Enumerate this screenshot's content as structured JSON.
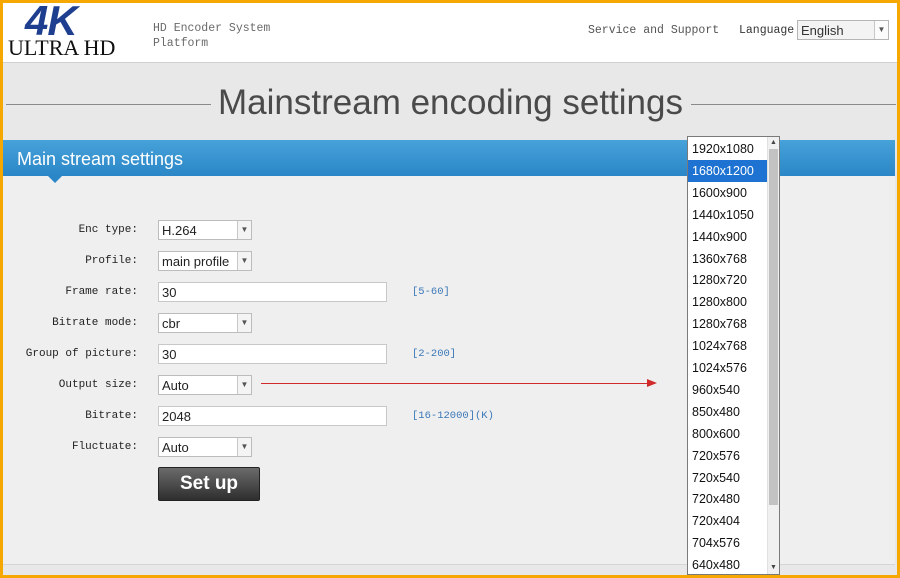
{
  "header": {
    "logo_top": "4K",
    "logo_bottom": "ULTRA HD",
    "system_title": "HD Encoder System Platform",
    "support_link": "Service and Support",
    "language_label": "Language:",
    "language_value": "English"
  },
  "page_title": "Mainstream encoding settings",
  "section_title": "Main stream settings",
  "form": {
    "enc_type": {
      "label": "Enc type:",
      "value": "H.264"
    },
    "profile": {
      "label": "Profile:",
      "value": "main profile"
    },
    "frame_rate": {
      "label": "Frame rate:",
      "value": "30",
      "hint": "[5-60]"
    },
    "bitrate_mode": {
      "label": "Bitrate mode:",
      "value": "cbr"
    },
    "gop": {
      "label": "Group of picture:",
      "value": "30",
      "hint": "[2-200]"
    },
    "output_size": {
      "label": "Output size:",
      "value": "Auto"
    },
    "bitrate": {
      "label": "Bitrate:",
      "value": "2048",
      "hint": "[16-12000](K)"
    },
    "fluctuate": {
      "label": "Fluctuate:",
      "value": "Auto"
    }
  },
  "setup_button": "Set up",
  "dropdown": {
    "selected": "1680x1200",
    "options": [
      "1920x1080",
      "1680x1200",
      "1600x900",
      "1440x1050",
      "1440x900",
      "1360x768",
      "1280x720",
      "1280x800",
      "1280x768",
      "1024x768",
      "1024x576",
      "960x540",
      "850x480",
      "800x600",
      "720x576",
      "720x540",
      "720x480",
      "720x404",
      "704x576",
      "640x480"
    ]
  },
  "colors": {
    "accent": "#2a86c6",
    "selection": "#1e73d2",
    "border": "#f6a800",
    "arrow": "#d12a2a"
  }
}
